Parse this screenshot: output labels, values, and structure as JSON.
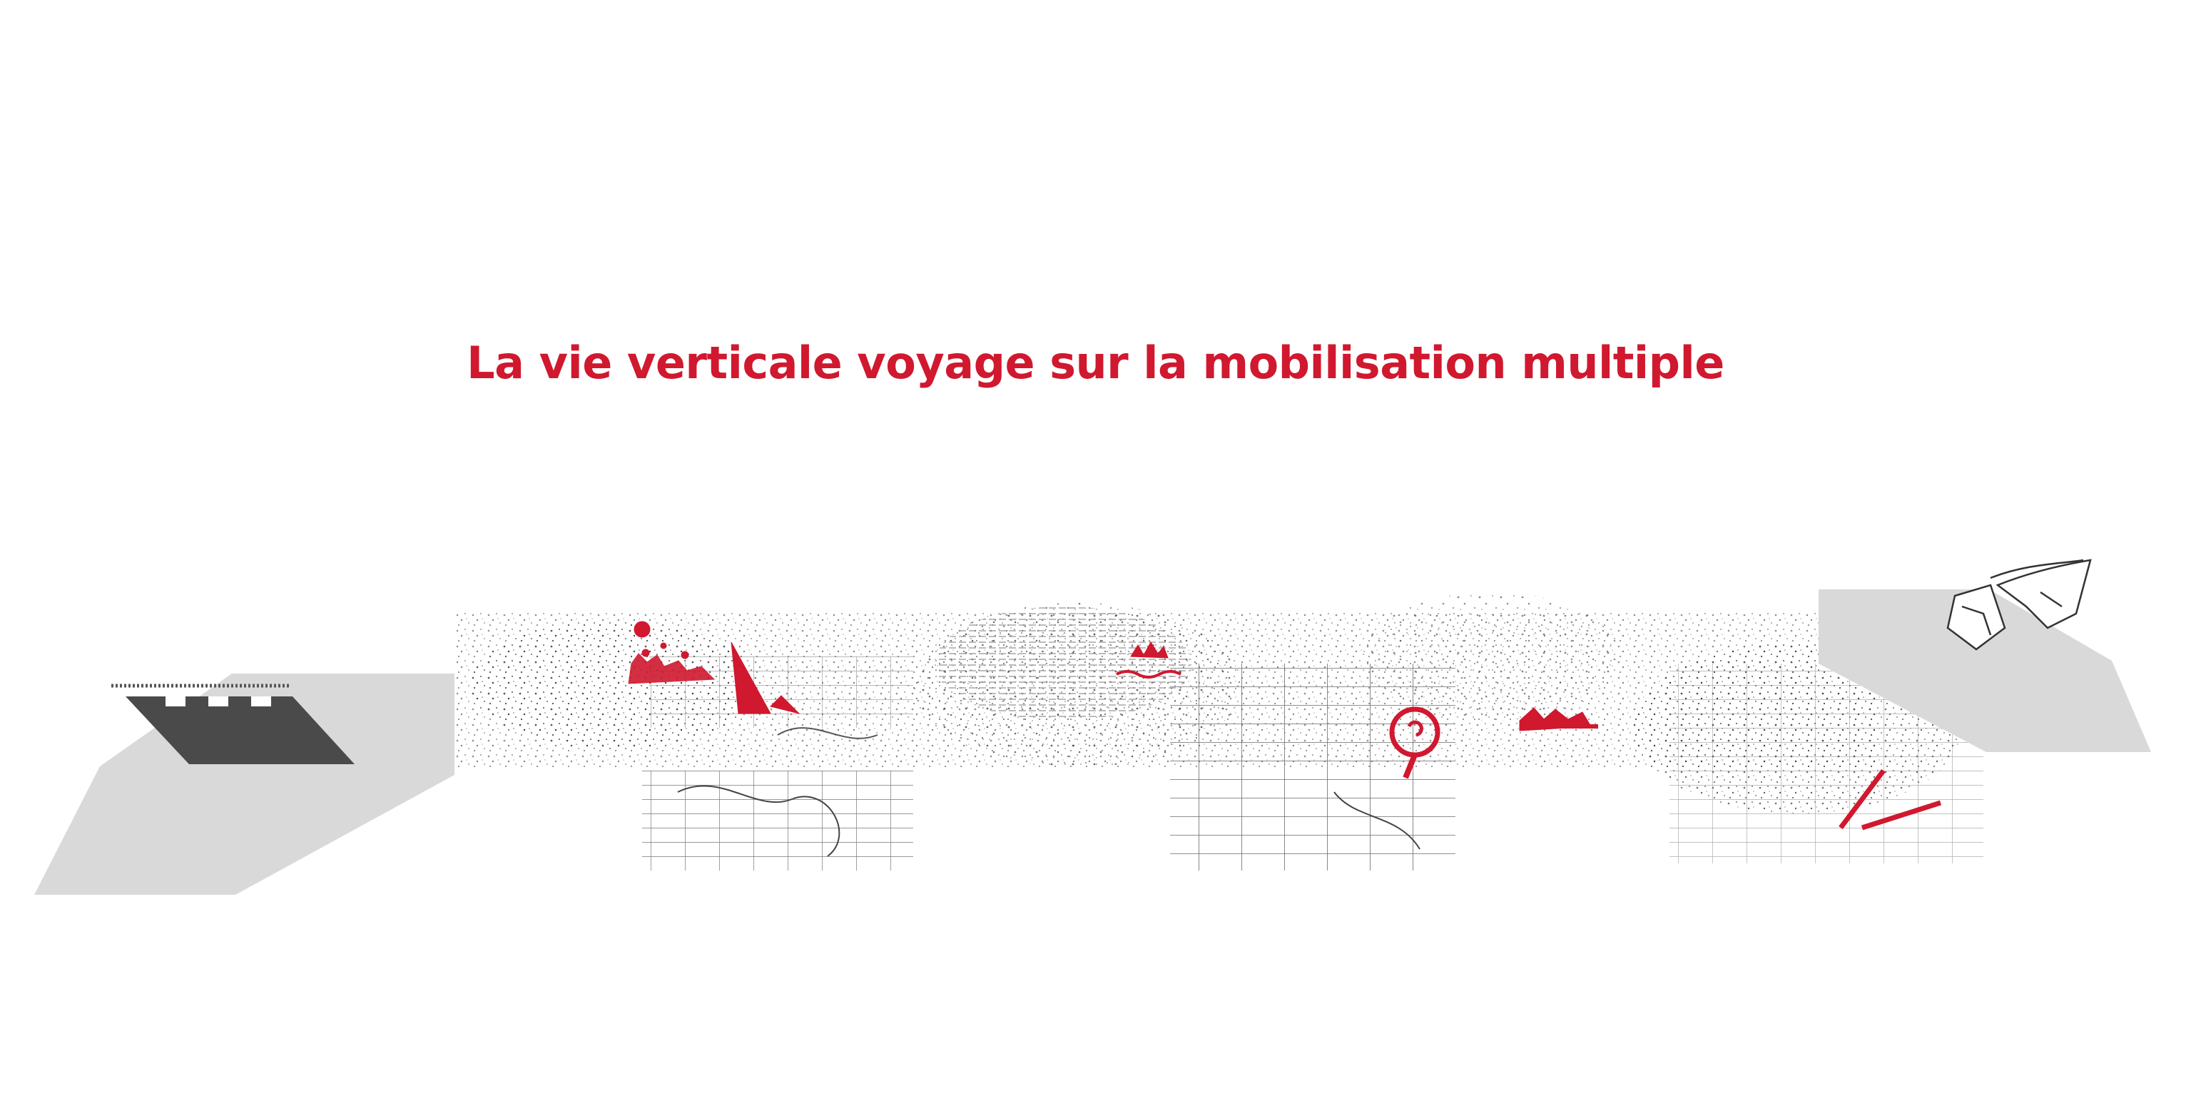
{
  "headline": {
    "text": "La vie verticale voyage sur la mobilisation multiple"
  },
  "colors": {
    "accent": "#d0182f",
    "background": "#ffffff",
    "platform": "#d9d9d9",
    "dark_block": "#4a4a4a",
    "ink": "#1a1a1a"
  },
  "illustration": {
    "icons": [
      "left-platform",
      "dark-block",
      "stippled-panorama",
      "tile-grids",
      "red-sketch-marks",
      "right-platform",
      "folded-strip-sketch"
    ]
  }
}
